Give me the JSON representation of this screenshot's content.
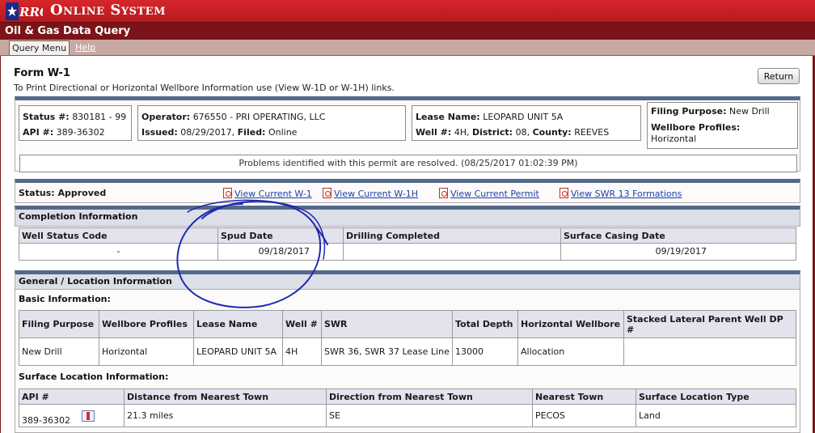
{
  "header": {
    "logo_text": "RRC",
    "system_title": "Online System",
    "app_title": "Oil & Gas Data Query"
  },
  "nav": {
    "query_menu": "Query Menu",
    "help": "Help"
  },
  "form": {
    "title": "Form W-1",
    "subtitle": "To Print Directional or Horizontal Wellbore Information use (View W-1D or W-1H) links.",
    "return_label": "Return"
  },
  "summary": {
    "status_label": "Status #:",
    "status_value": "830181 - 99",
    "api_label": "API #:",
    "api_value": "389-36302",
    "operator_label": "Operator:",
    "operator_value": "676550 - PRI OPERATING, LLC",
    "issued_label": "Issued:",
    "issued_value": "08/29/2017,",
    "filed_label": "Filed:",
    "filed_value": "Online",
    "lease_label": "Lease Name:",
    "lease_value": "LEOPARD UNIT 5A",
    "well_label": "Well #:",
    "well_value": "4H,",
    "district_label": "District:",
    "district_value": "08,",
    "county_label": "County:",
    "county_value": "REEVES",
    "filing_purpose_label": "Filing Purpose:",
    "filing_purpose_value": "New Drill",
    "wellbore_profiles_label": "Wellbore Profiles:",
    "wellbore_profiles_value": "Horizontal",
    "notice": "Problems identified with this permit are resolved. (08/25/2017 01:02:39 PM)"
  },
  "status_bar": {
    "status": "Status: Approved",
    "links": [
      "View Current W-1",
      "View Current W-1H",
      "View Current Permit",
      "View SWR 13 Formations"
    ]
  },
  "completion": {
    "heading": "Completion Information",
    "headers": [
      "Well Status Code",
      "Spud Date",
      "Drilling Completed",
      "Surface Casing Date"
    ],
    "values": [
      "-",
      "09/18/2017",
      "",
      "09/19/2017"
    ]
  },
  "general": {
    "heading": "General / Location Information",
    "basic_heading": "Basic Information:",
    "basic_headers": [
      "Filing Purpose",
      "Wellbore Profiles",
      "Lease Name",
      "Well #",
      "SWR",
      "Total Depth",
      "Horizontal Wellbore",
      "Stacked Lateral Parent Well DP #"
    ],
    "basic_row": [
      "New Drill",
      "Horizontal",
      "LEOPARD UNIT 5A",
      "4H",
      "SWR 36, SWR 37 Lease Line",
      "13000",
      "Allocation",
      ""
    ],
    "surface_heading": "Surface Location Information:",
    "surface_headers": [
      "API #",
      "Distance from Nearest Town",
      "Direction from Nearest Town",
      "Nearest Town",
      "Surface Location Type"
    ],
    "surface_row": [
      "389-36302",
      "21.3 miles",
      "SE",
      "PECOS",
      "Land"
    ]
  },
  "colors": {
    "brand_red": "#c41e24",
    "nav_blue": "#55698a",
    "link": "#1c3fa8",
    "annotation": "#1f2ab0"
  }
}
